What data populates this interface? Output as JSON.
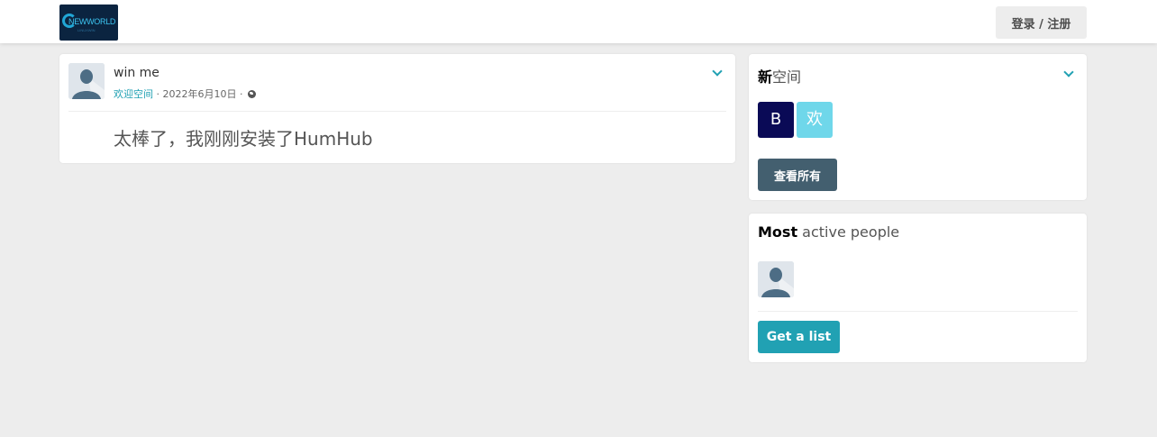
{
  "header": {
    "logo_text": "NEWWORLD",
    "logo_subtext": "LINUXWIN",
    "login_label": "登录 / 注册"
  },
  "post": {
    "author": "win me",
    "space": "欢迎空间",
    "separator_1": " · ",
    "date": "2022年6月10日",
    "separator_2": " · ",
    "visibility_icon": "globe-icon",
    "content": "太棒了，我刚刚安装了HumHub"
  },
  "spaces_panel": {
    "title_bold": "新",
    "title_rest": "空间",
    "tiles": [
      {
        "letter": "B",
        "color": "#0a0a56"
      },
      {
        "letter": "欢",
        "color": "#6fd7ea"
      }
    ],
    "view_all_label": "查看所有"
  },
  "people_panel": {
    "title_bold": "Most",
    "title_rest": " active people",
    "get_list_label": "Get a list"
  },
  "colors": {
    "accent": "#21a1b3",
    "dark_button": "#435f6f",
    "background": "#ededed"
  }
}
